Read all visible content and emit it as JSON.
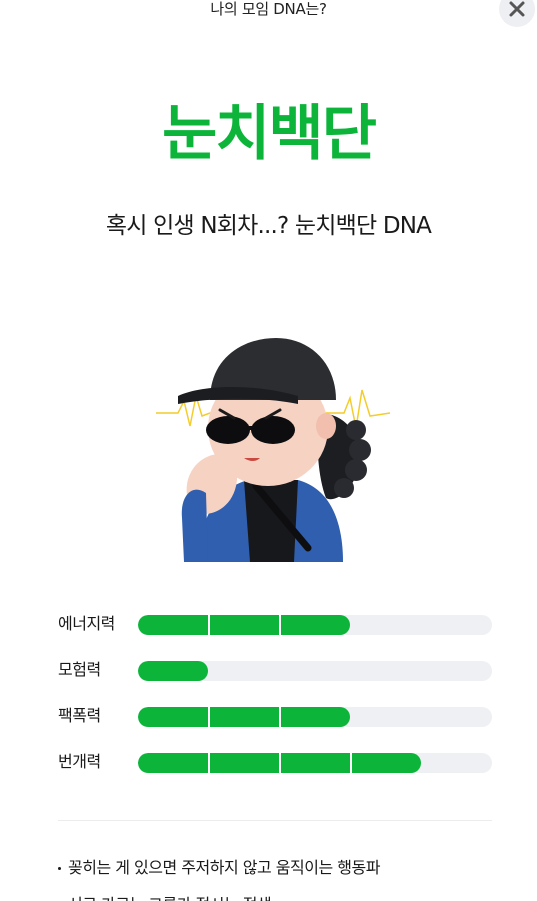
{
  "header": {
    "title": "나의 모임 DNA는?",
    "close_icon": "close-icon"
  },
  "result": {
    "name": "눈치백단",
    "tagline": "혹시 인생 N회차...? 눈치백단 DNA",
    "accent_color": "#0cb53a"
  },
  "character": {
    "image": "character-illustration",
    "description_icon": "person-with-cap-and-sunglasses"
  },
  "stats": [
    {
      "label": "에너지력",
      "level": 3,
      "max": 5
    },
    {
      "label": "모험력",
      "level": 1,
      "max": 5
    },
    {
      "label": "팩폭력",
      "level": 3,
      "max": 5
    },
    {
      "label": "번개력",
      "level": 4,
      "max": 5
    }
  ],
  "descriptions": [
    "꽂히는 게 있으면 주저하지 않고 움직이는 행동파",
    "서로 가르는 그룹가 적시는 적생"
  ]
}
